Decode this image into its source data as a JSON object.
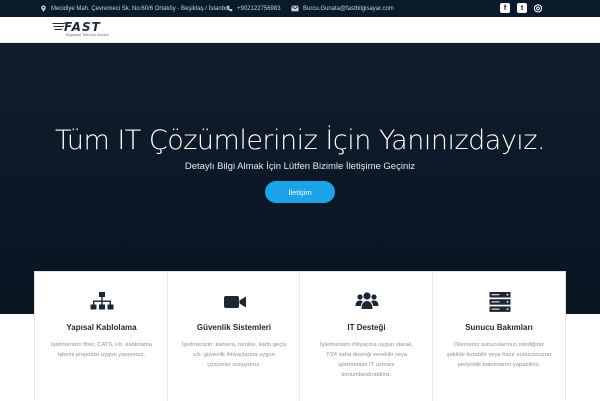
{
  "topbar": {
    "address": "Mecidiye Mah. Çevremeci Sk. No:60/6 Ortaköy - Beşiktaş / İstanbul",
    "phone": "+902122756983",
    "email": "Burcu.Gunata@fastbilgisayar.com",
    "social": {
      "facebook": "f",
      "twitter": "t",
      "instagram": "◎"
    },
    "icons": [
      "map-pin-icon",
      "phone-icon",
      "envelope-icon",
      "facebook-icon",
      "twitter-icon",
      "instagram-icon"
    ]
  },
  "header": {
    "logo_text": "FAST",
    "logo_subtitle": "Bilgisayar Teknoloji Ürünleri"
  },
  "hero": {
    "title": "Tüm IT Çözümleriniz İçin Yanınızdayız.",
    "subtitle": "Detaylı Bilgi Almak İçin Lütfen Bizimle İletişime Geçiniz",
    "button_label": "İletişim",
    "button_color": "#1aa3e8"
  },
  "services": [
    {
      "title": "Yapısal Kablolama",
      "description": "İşletmenizin fiber, CAT6, v.b. kablolama işlerini projenize uygun yapıyoruz.",
      "icon": "network-icon"
    },
    {
      "title": "Güvenlik Sistemleri",
      "description": "İşletmenizin; kamera, turnike, kartlı geçiş v.b. güvenlik ihtiyaçlarına uygun çözümler sunuyoruz.",
      "icon": "video-camera-icon"
    },
    {
      "title": "IT Desteği",
      "description": "İşletmenizin ihtiyacına uygun olarak, 7/24 saha desteği verebilir veya işletmenize IT uzmanı konumlandırabiliriz.",
      "icon": "users-icon"
    },
    {
      "title": "Sunucu Bakımları",
      "description": "Dilerseniz sunucularınızı istediğiniz şekilde kurabilir veya hazır sunucunuzun periyodik bakımlarını yapabiliriz.",
      "icon": "server-icon"
    }
  ]
}
